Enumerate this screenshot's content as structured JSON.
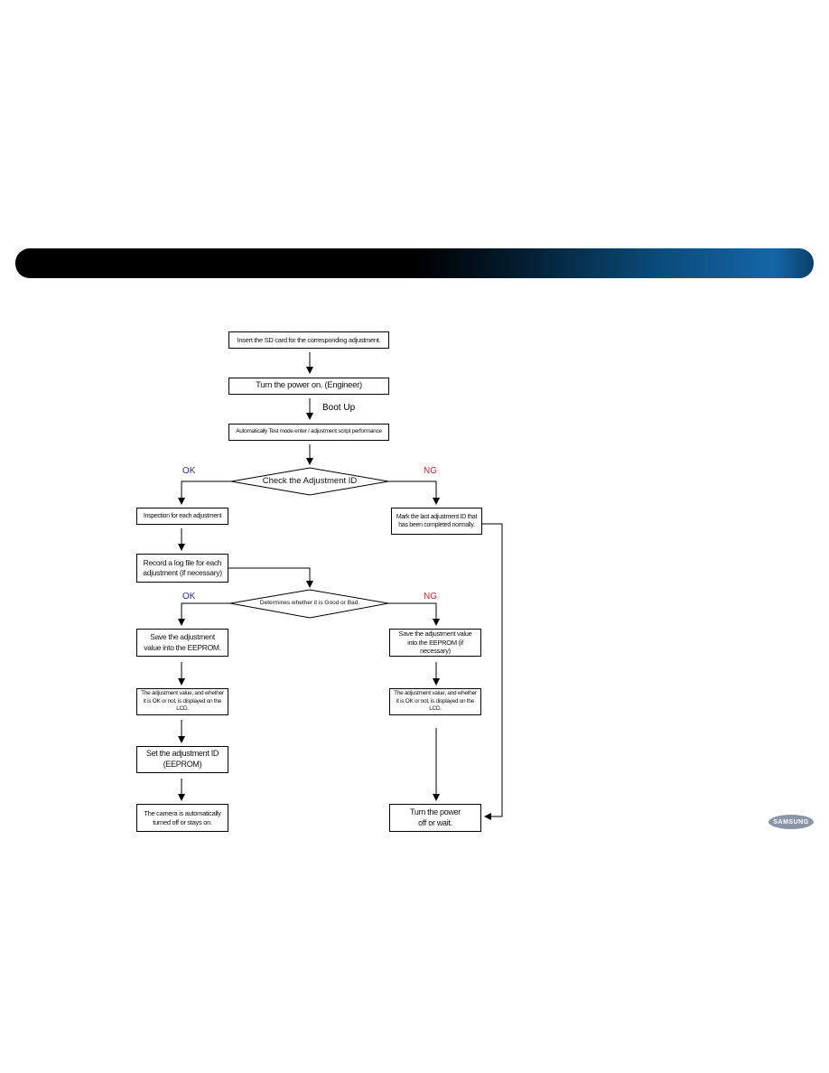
{
  "flowchart": {
    "steps": {
      "insert_sd": "Insert the SD card for the corresponding adjustment.",
      "power_on": "Turn the power on. (Engineer)",
      "boot_up": "Boot Up",
      "auto_test": "Automatically Test mode enter / adjustment script performance",
      "check_id": "Check the Adjustment ID",
      "inspection": "Inspection for each adjustment",
      "mark_last": "Mark the last adjustment ID that has been completed normally.",
      "record_log": "Record a log file for each adjustment (if necessary)",
      "good_or_bad": "Determines whether it is Good or Bad.",
      "save_ok": "Save the adjustment value into the EEPROM.",
      "save_ng": "Save the adjustment value into the EEPROM (if necessary)",
      "display_ok": "The adjustment value, and whether it is OK or not, is displayed on the LCD.",
      "display_ng": "The adjustment value, and whether it is OK or not, is displayed on the LCD.",
      "set_id": "Set the adjustment ID (EEPROM)",
      "camera_off": "The camera is automatically turned off or stays on.",
      "power_off": "Turn the power off or wait."
    },
    "labels": {
      "ok": "OK",
      "ng": "NG"
    },
    "colors": {
      "ok": "#2b2b9a",
      "ng": "#c0282d",
      "banner_accent": "#1566a8"
    }
  },
  "logo": "SAMSUNG"
}
